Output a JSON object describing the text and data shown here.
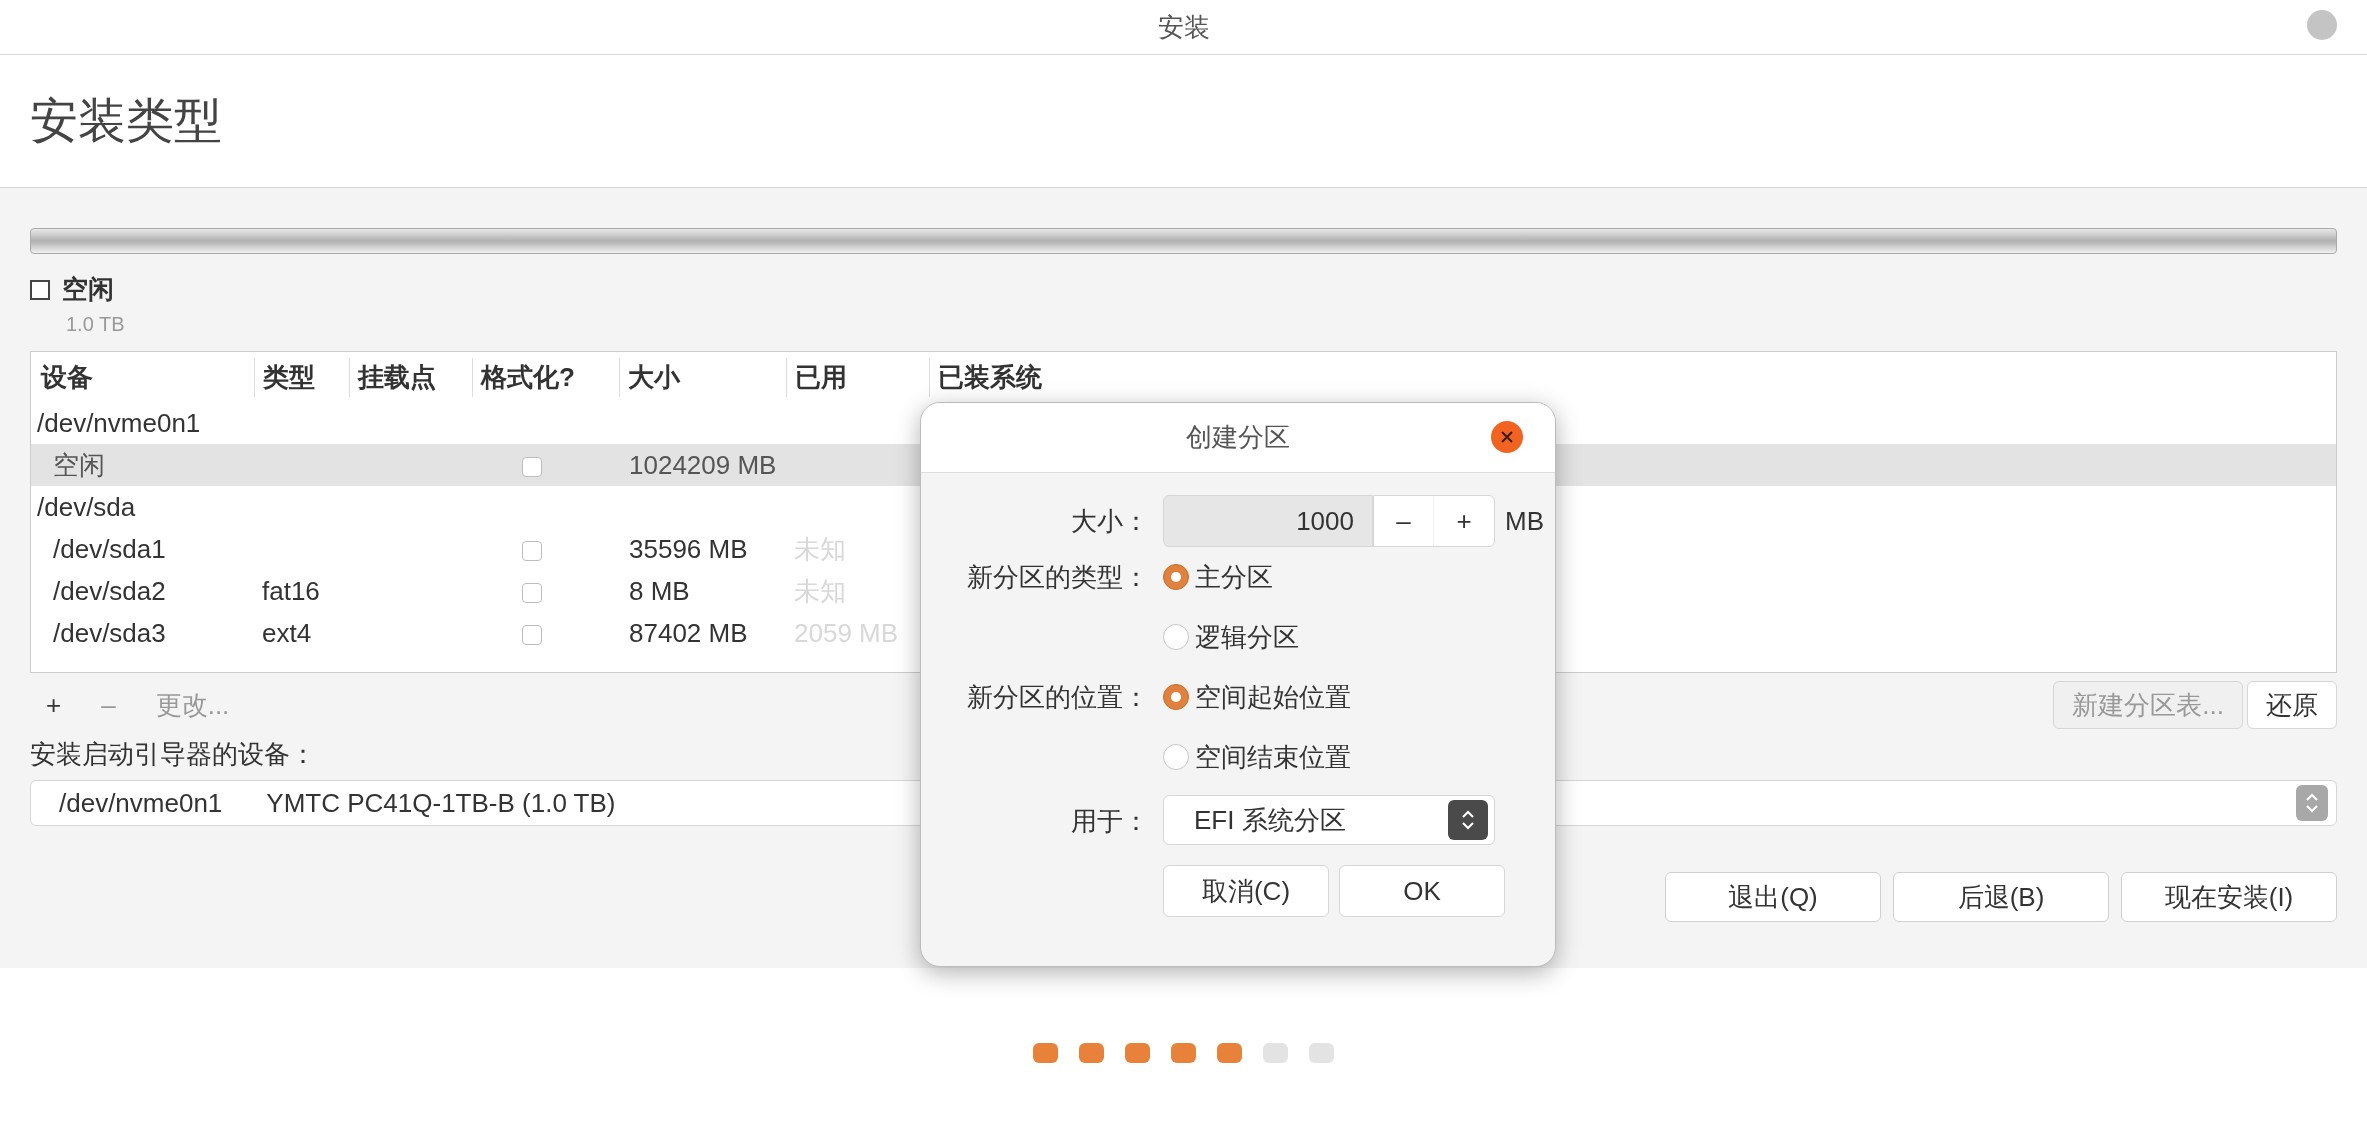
{
  "window": {
    "title": "安装"
  },
  "page_title": "安装类型",
  "legend": [
    {
      "label": "空闲",
      "size": "1.0 TB"
    }
  ],
  "table": {
    "columns": [
      "设备",
      "类型",
      "挂载点",
      "格式化?",
      "大小",
      "已用",
      "已装系统"
    ],
    "rows": [
      {
        "kind": "disk",
        "device": "/dev/nvme0n1",
        "selected": false
      },
      {
        "kind": "partition",
        "device": "空闲",
        "type": "",
        "format": false,
        "size": "1024209 MB",
        "used": "",
        "selected": true
      },
      {
        "kind": "disk",
        "device": "/dev/sda",
        "selected": false
      },
      {
        "kind": "partition",
        "device": "/dev/sda1",
        "type": "",
        "format": false,
        "size": "35596 MB",
        "used": "未知",
        "selected": false
      },
      {
        "kind": "partition",
        "device": "/dev/sda2",
        "type": "fat16",
        "format": false,
        "size": "8 MB",
        "used": "未知",
        "selected": false
      },
      {
        "kind": "partition",
        "device": "/dev/sda3",
        "type": "ext4",
        "format": false,
        "size": "87402 MB",
        "used": "2059 MB",
        "selected": false
      }
    ]
  },
  "toolbar": [
    {
      "label": "+",
      "disabled": false
    },
    {
      "label": "–",
      "disabled": true
    },
    {
      "label": "更改...",
      "disabled": true
    }
  ],
  "table_buttons": [
    {
      "label": "新建分区表...",
      "disabled": true
    },
    {
      "label": "还原",
      "disabled": false
    }
  ],
  "bootloader": {
    "label": "安装启动引导器的设备：",
    "device": "/dev/nvme0n1",
    "model": "YMTC PC41Q-1TB-B (1.0 TB)"
  },
  "actions": [
    "退出(Q)",
    "后退(B)",
    "现在安装(I)"
  ],
  "progress_dots": [
    {
      "done": true
    },
    {
      "done": true
    },
    {
      "done": true
    },
    {
      "done": true
    },
    {
      "done": true
    },
    {
      "done": false
    },
    {
      "done": false
    }
  ],
  "dialog": {
    "title": "创建分区",
    "size_label": "大小：",
    "size_value": "1000",
    "decrement": "–",
    "increment": "+",
    "unit": "MB",
    "type_label": "新分区的类型：",
    "type_options": [
      {
        "label": "主分区",
        "selected": true
      },
      {
        "label": "逻辑分区",
        "selected": false
      }
    ],
    "location_label": "新分区的位置：",
    "location_options": [
      {
        "label": "空间起始位置",
        "selected": true
      },
      {
        "label": "空间结束位置",
        "selected": false
      }
    ],
    "use_label": "用于：",
    "use_value": "EFI 系统分区",
    "buttons": [
      "取消(C)",
      "OK"
    ]
  }
}
